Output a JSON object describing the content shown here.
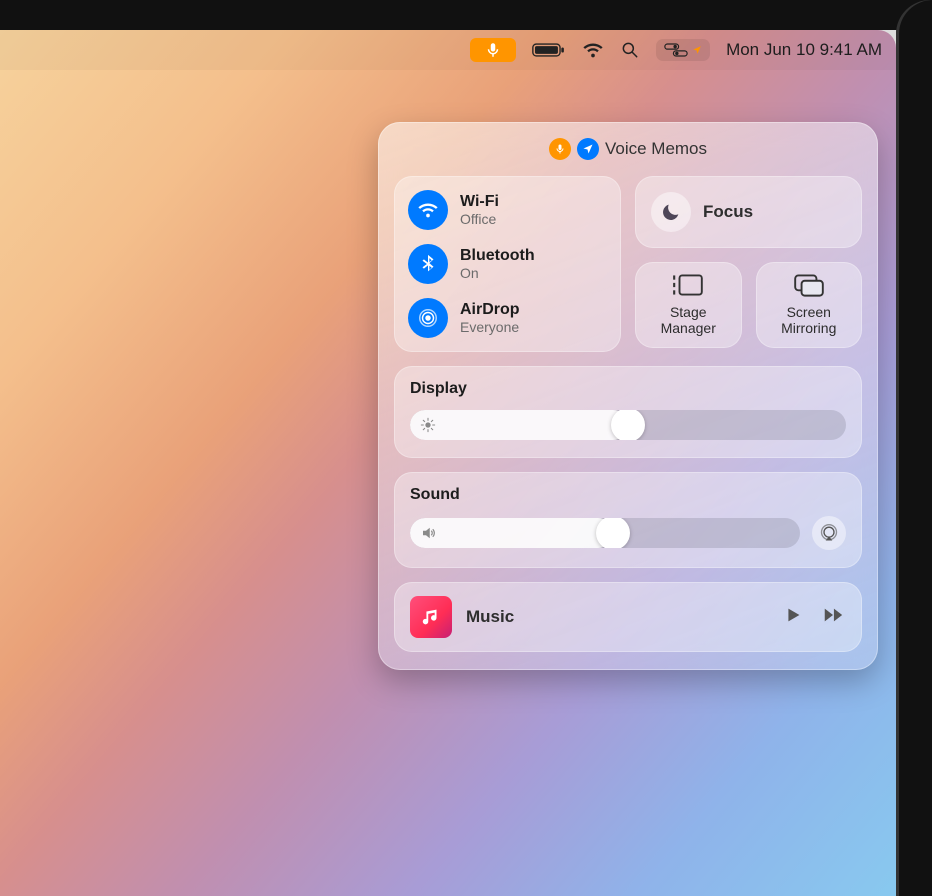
{
  "menubar": {
    "datetime": "Mon Jun 10  9:41 AM"
  },
  "header": {
    "active_app": "Voice Memos"
  },
  "connectivity": {
    "wifi": {
      "title": "Wi-Fi",
      "status": "Office"
    },
    "bluetooth": {
      "title": "Bluetooth",
      "status": "On"
    },
    "airdrop": {
      "title": "AirDrop",
      "status": "Everyone"
    }
  },
  "focus": {
    "title": "Focus"
  },
  "tiles": {
    "stage_manager": "Stage\nManager",
    "screen_mirroring": "Screen\nMirroring"
  },
  "display": {
    "label": "Display",
    "value_pct": 50
  },
  "sound": {
    "label": "Sound",
    "value_pct": 52
  },
  "media": {
    "app": "Music"
  }
}
